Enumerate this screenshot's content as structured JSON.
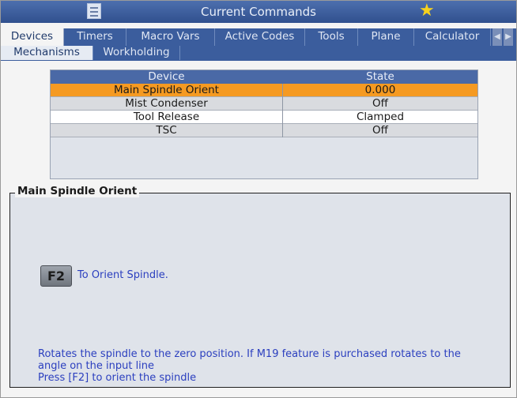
{
  "window": {
    "title": "Current Commands"
  },
  "icons": {
    "menu": "hamburger-menu-icon",
    "favorite": "star-icon",
    "scroll_left": "arrow-left-icon",
    "scroll_right": "arrow-right-icon"
  },
  "colors": {
    "title_bar": "#30508e",
    "tab_bar": "#3b5d9d",
    "table_header": "#4a69a6",
    "selected_row": "#f59a22",
    "help_text": "#2b3fbf",
    "star": "#f7d21c"
  },
  "tabs": [
    {
      "label": "Devices"
    },
    {
      "label": "Timers"
    },
    {
      "label": "Macro Vars"
    },
    {
      "label": "Active Codes"
    },
    {
      "label": "Tools"
    },
    {
      "label": "Plane"
    },
    {
      "label": "Calculator"
    }
  ],
  "subtabs": [
    {
      "label": "Mechanisms"
    },
    {
      "label": "Workholding"
    }
  ],
  "table": {
    "columns": [
      "Device",
      "State"
    ],
    "rows": [
      {
        "device": "Main Spindle Orient",
        "state": "0.000",
        "selected": true
      },
      {
        "device": "Mist Condenser",
        "state": "Off"
      },
      {
        "device": "Tool Release",
        "state": "Clamped"
      },
      {
        "device": "TSC",
        "state": "Off"
      }
    ]
  },
  "panel": {
    "title": "Main Spindle Orient",
    "key_label": "F2",
    "key_action": "To Orient Spindle.",
    "description_line1": "Rotates the spindle to the zero position. If M19 feature is purchased rotates to the",
    "description_line2": "angle on the input line",
    "description_line3": "Press [F2] to orient the spindle"
  }
}
